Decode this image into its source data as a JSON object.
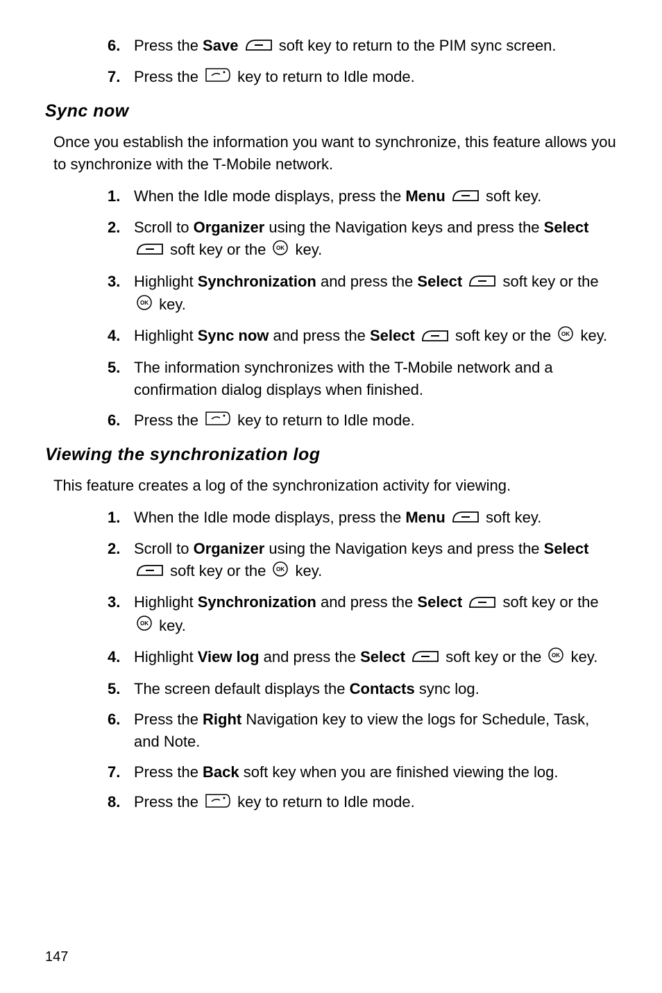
{
  "topList": {
    "items": [
      {
        "num": "6.",
        "pre": "Press the ",
        "bold": "Save",
        "icon": "softkey",
        "post": " soft key to return to the PIM sync screen."
      },
      {
        "num": "7.",
        "pre": "Press the ",
        "icon": "end",
        "post": " key to return to Idle mode."
      }
    ]
  },
  "section1": {
    "title": "Sync now",
    "intro": "Once you establish the information you want to synchronize, this feature allows you to synchronize with the T-Mobile network.",
    "items": {
      "i1_num": "1.",
      "i1_pre": "When the Idle mode displays, press the ",
      "i1_bold": "Menu",
      "i1_post": " soft key.",
      "i2_num": "2.",
      "i2_a": "Scroll to ",
      "i2_b": "Organizer",
      "i2_c": " using the Navigation keys and press the ",
      "i2_d": "Select",
      "i2_e": " soft key or the ",
      "i2_f": " key.",
      "i3_num": "3.",
      "i3_a": "Highlight ",
      "i3_b": "Synchronization",
      "i3_c": " and press the ",
      "i3_d": "Select",
      "i3_e": " soft key or the ",
      "i3_f": " key.",
      "i4_num": "4.",
      "i4_a": "Highlight ",
      "i4_b": "Sync now",
      "i4_c": " and press the ",
      "i4_d": "Select",
      "i4_e": " soft key or the ",
      "i4_f": " key.",
      "i5_num": "5.",
      "i5_text": "The information synchronizes with the T-Mobile network and a confirmation dialog displays when finished.",
      "i6_num": "6.",
      "i6_a": "Press the ",
      "i6_b": " key to return to Idle mode."
    }
  },
  "section2": {
    "title": "Viewing the synchronization log",
    "intro": "This feature creates a log of the synchronization activity for viewing.",
    "items": {
      "i1_num": "1.",
      "i1_pre": "When the Idle mode displays, press the ",
      "i1_bold": "Menu",
      "i1_post": " soft key.",
      "i2_num": "2.",
      "i2_a": "Scroll to ",
      "i2_b": "Organizer",
      "i2_c": " using the Navigation keys and press the ",
      "i2_d": "Select",
      "i2_e": " soft key or the ",
      "i2_f": " key.",
      "i3_num": "3.",
      "i3_a": "Highlight ",
      "i3_b": "Synchronization",
      "i3_c": " and press the ",
      "i3_d": "Select",
      "i3_e": " soft key or the ",
      "i3_f": " key.",
      "i4_num": "4.",
      "i4_a": "Highlight ",
      "i4_b": "View log",
      "i4_c": " and press the ",
      "i4_d": "Select",
      "i4_e": " soft key or the ",
      "i4_f": " key.",
      "i5_num": "5.",
      "i5_a": "The screen default displays the ",
      "i5_b": "Contacts",
      "i5_c": " sync log.",
      "i6_num": "6.",
      "i6_a": "Press the ",
      "i6_b": "Right",
      "i6_c": " Navigation key to view the logs for Schedule, Task, and Note.",
      "i7_num": "7.",
      "i7_a": "Press the ",
      "i7_b": "Back",
      "i7_c": " soft key when you are finished viewing the log.",
      "i8_num": "8.",
      "i8_a": "Press the ",
      "i8_b": " key to return to Idle mode."
    }
  },
  "pageNumber": "147"
}
